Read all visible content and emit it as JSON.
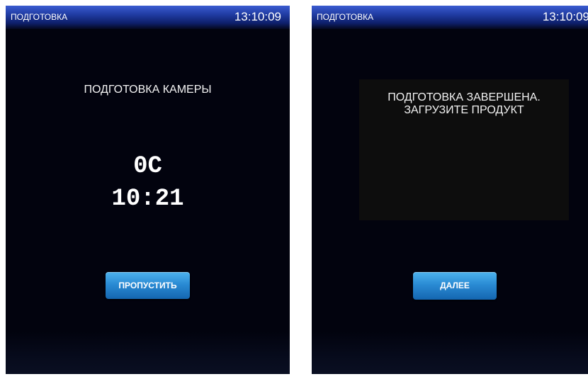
{
  "colors": {
    "screen_bg": "#02030e",
    "topbar_accent": "#2a46b8",
    "button_accent": "#2a8bd4",
    "message_box_bg": "#0d0d0d"
  },
  "left_screen": {
    "header": {
      "title": "ПОДГОТОВКА",
      "time": "13:10:09"
    },
    "status_label": "ПОДГОТОВКА КАМЕРЫ",
    "temperature": "0C",
    "timer": "10:21",
    "skip_button_label": "ПРОПУСТИТЬ"
  },
  "right_screen": {
    "header": {
      "title": "ПОДГОТОВКА",
      "time": "13:10:09"
    },
    "message_line1": "ПОДГОТОВКА ЗАВЕРШЕНА.",
    "message_line2": "ЗАГРУЗИТЕ ПРОДУКТ",
    "next_button_label": "ДАЛЕЕ"
  }
}
